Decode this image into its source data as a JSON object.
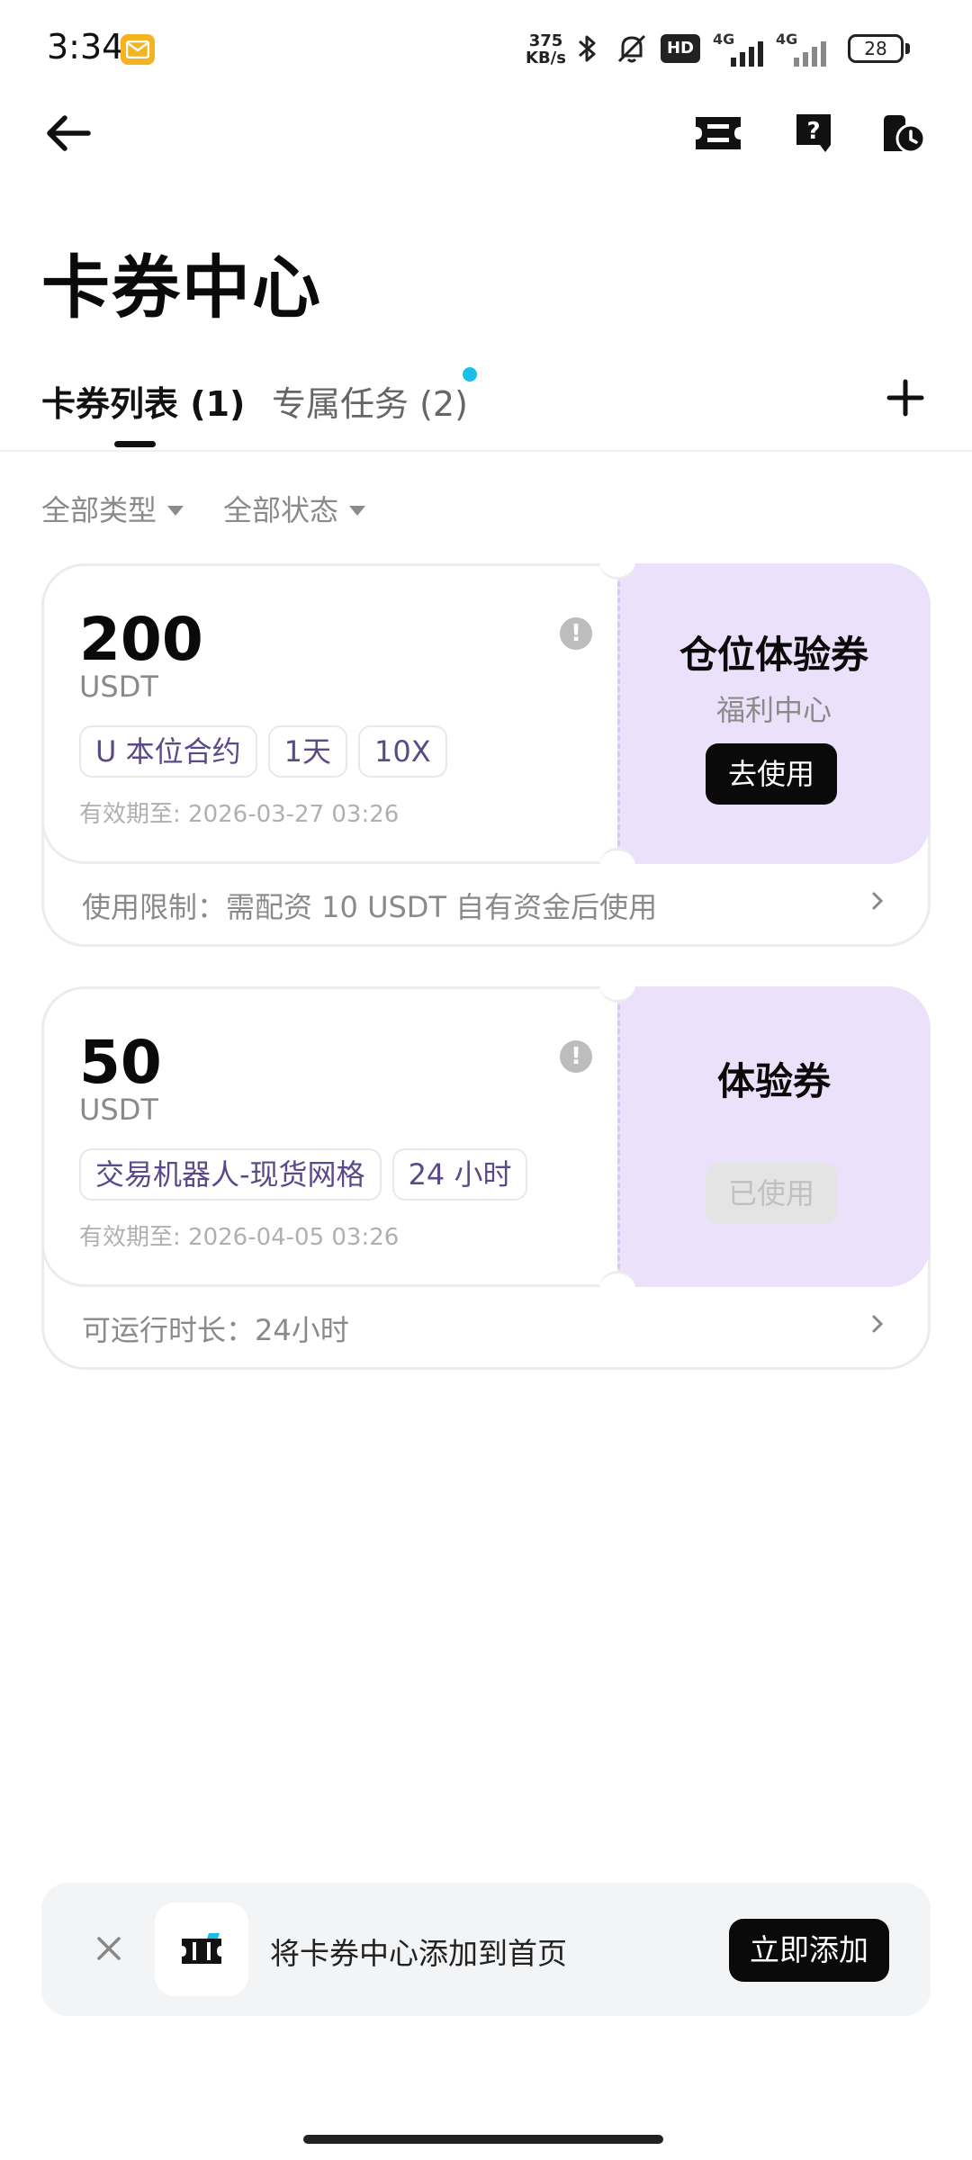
{
  "status_bar": {
    "time": "3:34",
    "net_speed_value": "375",
    "net_speed_unit": "KB/s",
    "hd_label": "HD",
    "signal_1_label": "4G",
    "signal_2_label": "4G",
    "battery": "28",
    "icons": [
      "mail-icon",
      "bluetooth-icon",
      "mute-bell-icon",
      "signal-icon",
      "battery-icon"
    ]
  },
  "header": {
    "back_icon": "arrow-left-icon",
    "action_icons": [
      "ticket-icon",
      "help-icon",
      "history-icon"
    ],
    "title": "卡券中心"
  },
  "tabs": [
    {
      "label": "卡券列表 (1)",
      "active": true
    },
    {
      "label": "专属任务 (2)",
      "active": false,
      "has_dot": true
    }
  ],
  "filters": [
    {
      "label": "全部类型"
    },
    {
      "label": "全部状态"
    }
  ],
  "cards": [
    {
      "amount": "200",
      "unit": "USDT",
      "tags": [
        "U 本位合约",
        "1天",
        "10X"
      ],
      "validity": "有效期至: 2026-03-27 03:26",
      "title": "仓位体验券",
      "subtitle": "福利中心",
      "button": "去使用",
      "button_state": "active",
      "footer": "使用限制：需配资 10 USDT 自有资金后使用"
    },
    {
      "amount": "50",
      "unit": "USDT",
      "tags": [
        "交易机器人-现货网格",
        "24 小时"
      ],
      "validity": "有效期至: 2026-04-05 03:26",
      "title": "体验券",
      "subtitle": "",
      "button": "已使用",
      "button_state": "disabled",
      "footer": "可运行时长：24小时"
    }
  ],
  "banner": {
    "text": "将卡券中心添加到首页",
    "button": "立即添加"
  },
  "colors": {
    "accent_purple": "#ece1fb",
    "primary_button": "#0a0a0a",
    "notification_dot": "#18c0e8",
    "muted_text": "#8a8a8a"
  }
}
